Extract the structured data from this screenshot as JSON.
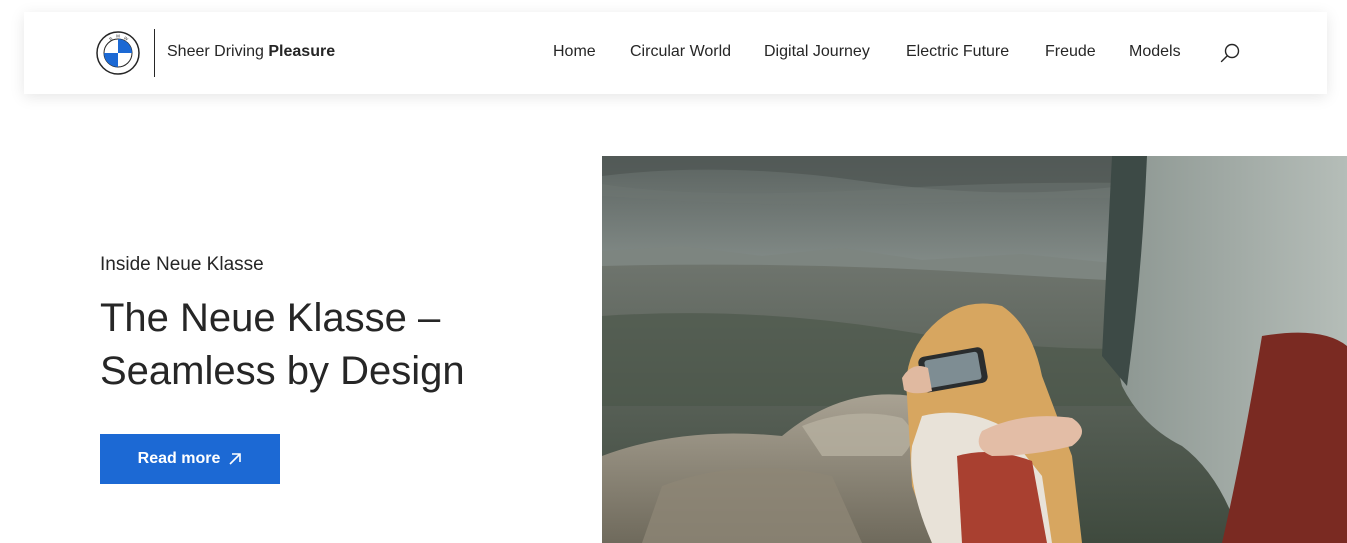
{
  "header": {
    "logo_icon": "bmw-roundel-icon",
    "tagline_regular": "Sheer Driving ",
    "tagline_bold": "Pleasure",
    "nav": [
      {
        "label": "Home"
      },
      {
        "label": "Circular World"
      },
      {
        "label": "Digital Journey"
      },
      {
        "label": "Electric Future"
      },
      {
        "label": "Freude"
      },
      {
        "label": "Models"
      }
    ],
    "search_icon": "search-icon"
  },
  "hero": {
    "eyebrow": "Inside Neue Klasse",
    "title_line1": "The Neue Klasse –",
    "title_line2": "Seamless by Design",
    "cta_label": "Read more",
    "cta_icon": "arrow-up-right-icon",
    "image_description_icon": "hero-photo"
  },
  "colors": {
    "accent": "#1c69d4",
    "text": "#262626",
    "bmw_blue": "#1c69d4"
  }
}
